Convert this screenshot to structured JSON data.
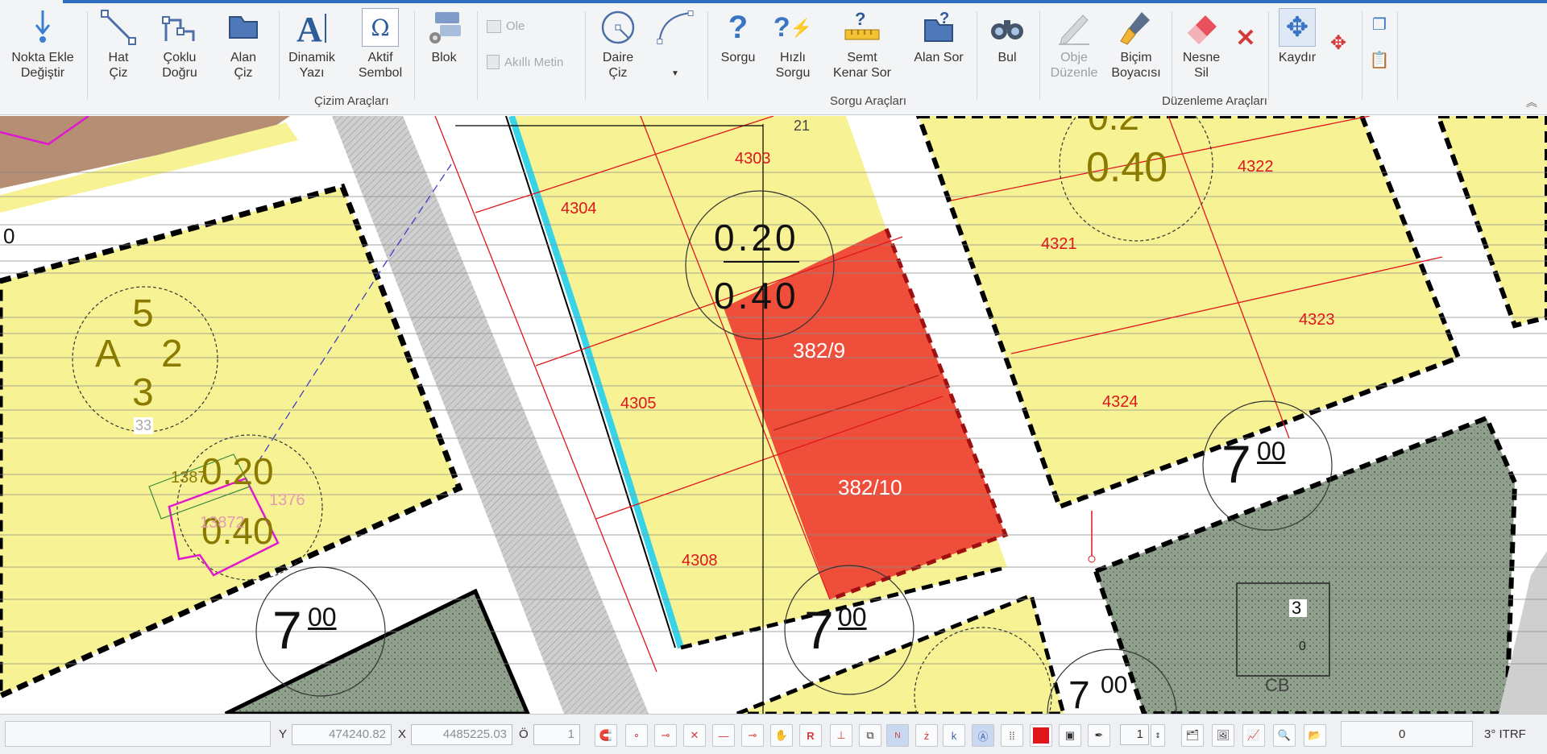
{
  "ribbon": {
    "buttons": {
      "nokta_ekle": "Nokta Ekle\nDeğiştir",
      "hat_ciz": "Hat\nÇiz",
      "coklu_dogru": "Çoklu\nDoğru",
      "alan_ciz": "Alan\nÇiz",
      "dinamik_yazi": "Dinamik\nYazı",
      "aktif_sembol": "Aktif\nSembol",
      "blok": "Blok",
      "ole": "Ole",
      "akilli_metin": "Akıllı Metin",
      "daire_ciz": "Daire\nÇiz",
      "sorgu": "Sorgu",
      "hizli_sorgu": "Hızlı\nSorgu",
      "semt_kenar_sor": "Semt\nKenar Sor",
      "alan_sor": "Alan Sor",
      "bul": "Bul",
      "obje_duzenle": "Obje\nDüzenle",
      "bicim_boyacisi": "Biçim\nBoyacısı",
      "nesne_sil": "Nesne\nSil",
      "kaydir": "Kaydır"
    },
    "groups": {
      "cizim": "Çizim Araçları",
      "sorgu": "Sorgu Araçları",
      "duzenleme": "Düzenleme Araçları"
    }
  },
  "map": {
    "colors": {
      "parcel_yellow": "#f7f394",
      "road_white": "#ffffff",
      "park_green": "#8a9a87",
      "brown_area": "#b58e74",
      "highlight_red": "#ef4f3a",
      "cyan_line": "#38d3e6",
      "label_red": "#e0161c"
    },
    "labels": {
      "l4303": "4303",
      "l4304": "4304",
      "l4305": "4305",
      "l4308": "4308",
      "l4321": "4321",
      "l4322": "4322",
      "l4323": "4323",
      "l4324": "4324",
      "l21": "21",
      "p382_9": "382/9",
      "p382_10": "382/10",
      "ratio_top_a": "0.20",
      "ratio_bot_a": "0.40",
      "ratio_top_b": "0.20",
      "ratio_bot_b": "0.40",
      "ratio_c": "0.40",
      "ratio_partial": "0.2",
      "block_a": "A",
      "block_5": "5",
      "block_2": "2",
      "block_3": "3",
      "block_33": "33",
      "seven_big": "7",
      "seven_sup": "00",
      "l1387": "1387",
      "l13872": "13872",
      "l1376": "1376",
      "l0": "0",
      "box3": "3",
      "cb": "CB",
      "p0": "0"
    }
  },
  "status": {
    "y_label": "Y",
    "y_value": "474240.82",
    "x_label": "X",
    "x_value": "4485225.03",
    "o_label": "Ö",
    "o_value": "1",
    "layer_num": "1",
    "count": "0",
    "crs": "3° ITRF"
  }
}
